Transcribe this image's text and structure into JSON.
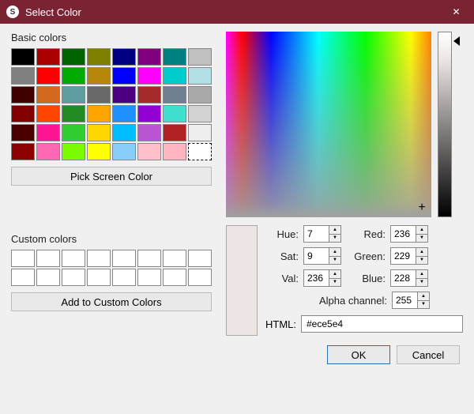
{
  "window": {
    "title": "Select Color"
  },
  "basic": {
    "label": "Basic colors",
    "colors": [
      "#000000",
      "#aa0000",
      "#006400",
      "#808000",
      "#000080",
      "#800080",
      "#008080",
      "#c0c0c0",
      "#808080",
      "#ff0000",
      "#00aa00",
      "#b8860b",
      "#0000ff",
      "#ff00ff",
      "#00cccc",
      "#b0e0e6",
      "#400000",
      "#d2691e",
      "#5f9ea0",
      "#696969",
      "#4b0082",
      "#a52a2a",
      "#708090",
      "#a9a9a9",
      "#800000",
      "#ff4500",
      "#228b22",
      "#ffa500",
      "#1e90ff",
      "#9400d3",
      "#40e0d0",
      "#d3d3d3",
      "#4b0000",
      "#ff1493",
      "#32cd32",
      "#ffd700",
      "#00bfff",
      "#ba55d3",
      "#b22222",
      "#eeeeee",
      "#8b0000",
      "#ff69b4",
      "#7cfc00",
      "#ffff00",
      "#87cefa",
      "#ffc0cb",
      "#ffb6c1",
      "#ffffff"
    ],
    "selected_index": 47
  },
  "pickscreen": {
    "label": "Pick Screen Color"
  },
  "custom": {
    "label": "Custom colors",
    "count": 16,
    "add_label": "Add to Custom Colors"
  },
  "fields": {
    "hue": {
      "label": "Hue:",
      "value": "7"
    },
    "sat": {
      "label": "Sat:",
      "value": "9"
    },
    "val": {
      "label": "Val:",
      "value": "236"
    },
    "red": {
      "label": "Red:",
      "value": "236"
    },
    "green": {
      "label": "Green:",
      "value": "229"
    },
    "blue": {
      "label": "Blue:",
      "value": "228"
    },
    "alpha": {
      "label": "Alpha channel:",
      "value": "255"
    },
    "html": {
      "label": "HTML:",
      "value": "#ece5e4"
    }
  },
  "preview_color": "#ece5e4",
  "buttons": {
    "ok": "OK",
    "cancel": "Cancel"
  }
}
